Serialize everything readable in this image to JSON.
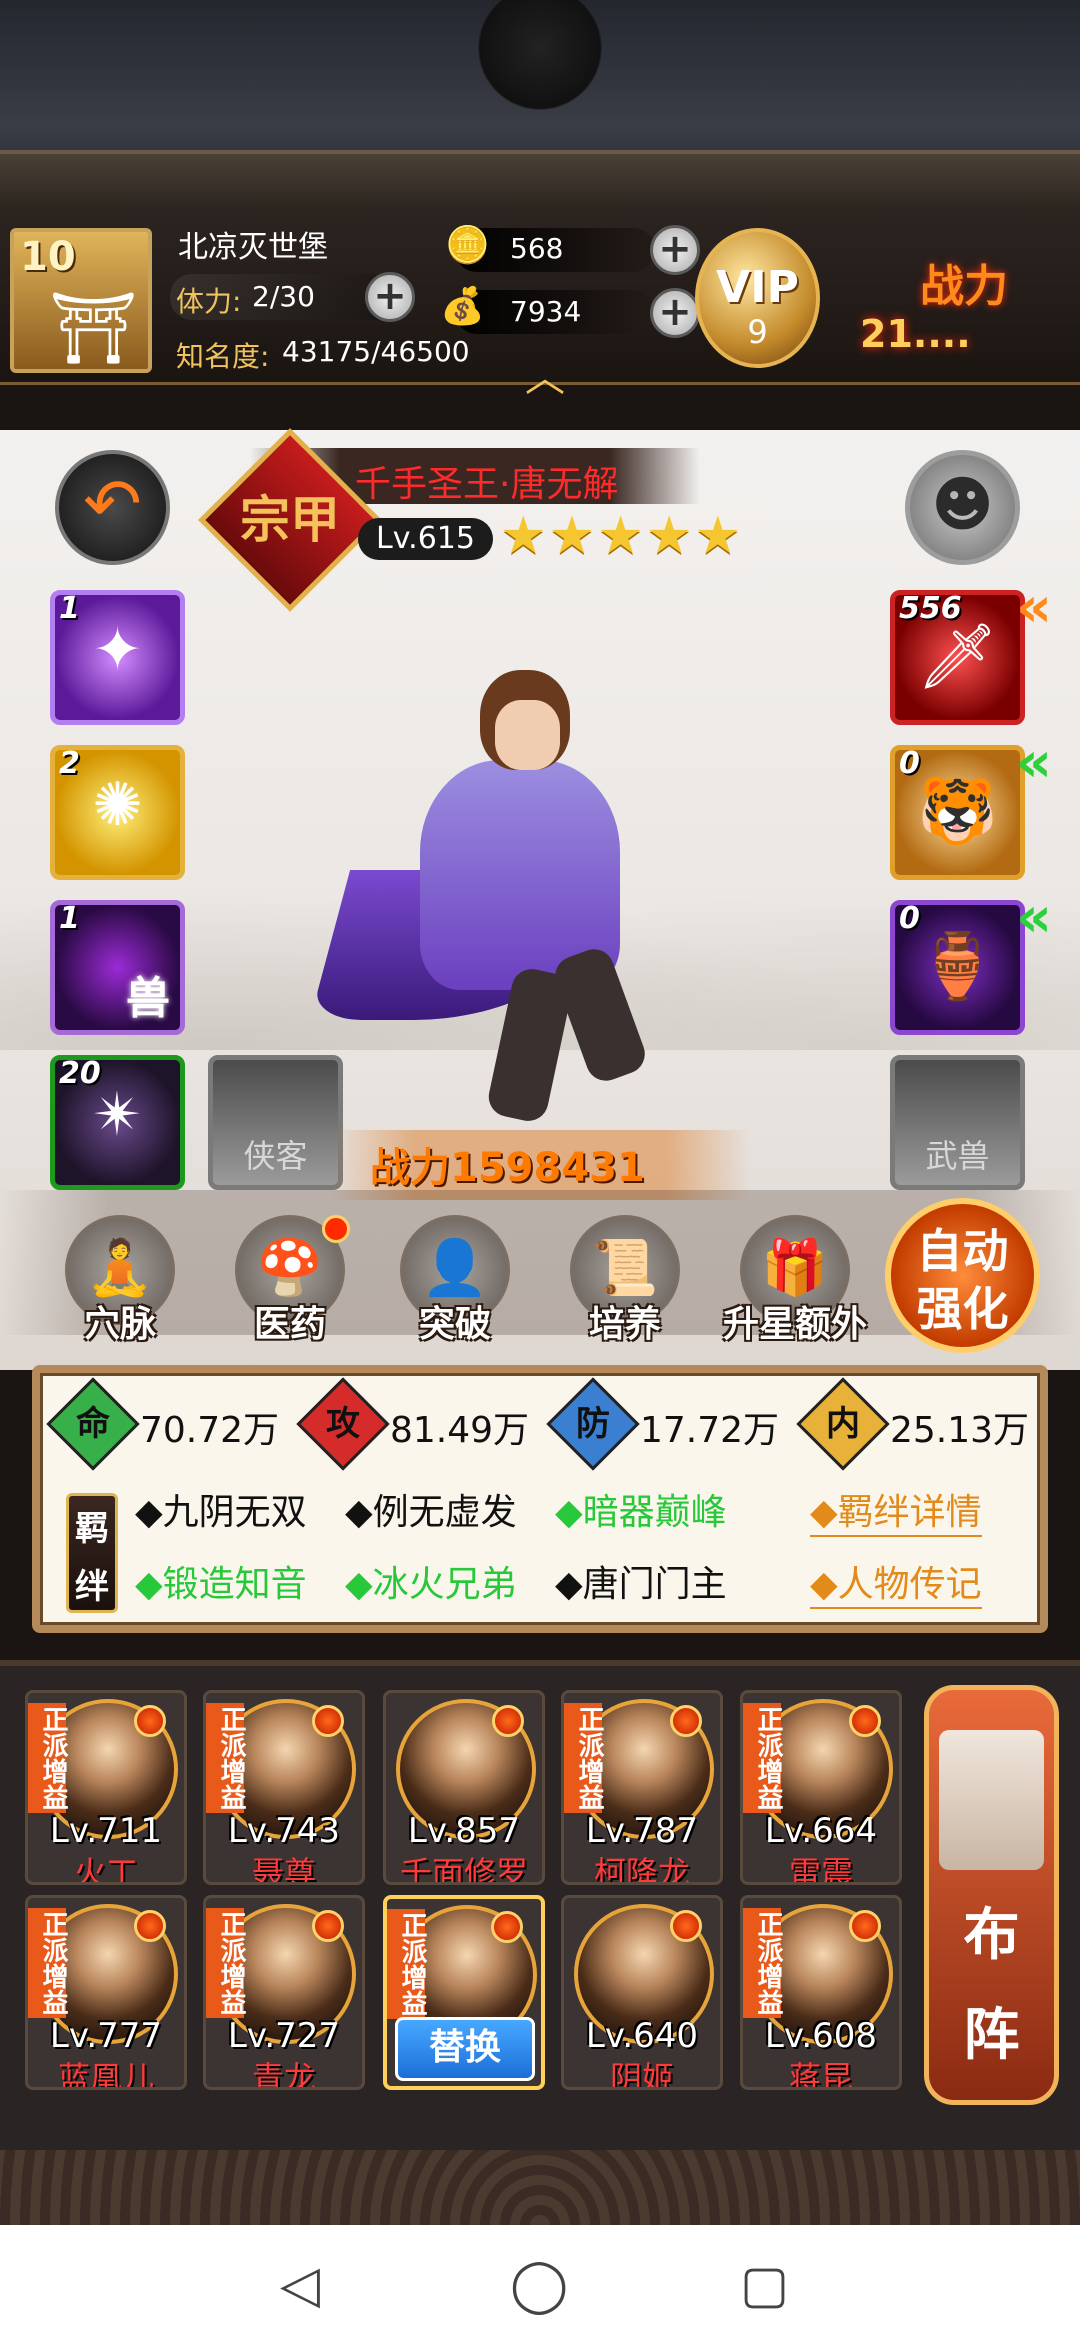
{
  "header": {
    "castle_level": "10",
    "castle_name": "北凉灭世堡",
    "stamina_label": "体力:",
    "stamina_value": "2/30",
    "fame_label": "知名度:",
    "fame_value": "43175/46500",
    "silver": "568",
    "gold": "7934",
    "vip_label": "VIP",
    "vip_level": "9",
    "power_label": "战力",
    "power_value": "21...."
  },
  "hero": {
    "rank_char": "宗甲",
    "name": "千手圣王·唐无解",
    "level": "Lv.615",
    "stars": "★★★★★",
    "power": "战力1598431"
  },
  "skills": [
    {
      "count": "1"
    },
    {
      "count": "2"
    },
    {
      "count": "1",
      "glyph_text": "兽"
    },
    {
      "count": "20"
    }
  ],
  "locked_slots": [
    {
      "label": "侠客"
    },
    {
      "label": "武兽"
    }
  ],
  "equipment": [
    {
      "count": "556"
    },
    {
      "count": "0"
    },
    {
      "count": "0"
    }
  ],
  "actions": [
    {
      "label": "穴脉",
      "icon": "meditation-icon"
    },
    {
      "label": "医药",
      "icon": "medicine-icon"
    },
    {
      "label": "突破",
      "icon": "breakthrough-icon"
    },
    {
      "label": "培养",
      "icon": "scroll-icon"
    },
    {
      "label": "升星额外",
      "icon": "star-up-icon"
    }
  ],
  "auto_button": {
    "line1": "自动",
    "line2": "强化"
  },
  "stats": {
    "life_icon": "命",
    "life": "70.72万",
    "attack_icon": "攻",
    "attack": "81.49万",
    "defense_icon": "防",
    "defense": "17.72万",
    "inner_icon": "内",
    "inner": "25.13万"
  },
  "bonds": {
    "seal": [
      "羁",
      "绊"
    ],
    "items": [
      {
        "text": "◆九阴无双"
      },
      {
        "text": "◆例无虚发"
      },
      {
        "text": "◆暗器巅峰"
      },
      {
        "text": "◆锻造知音"
      },
      {
        "text": "◆冰火兄弟"
      },
      {
        "text": "◆唐门门主"
      }
    ],
    "link_details": "◆羁绊详情",
    "link_bio": "◆人物传记"
  },
  "roster": {
    "tag": "正派增益",
    "heroes": [
      {
        "level": "Lv.711",
        "name": "火工"
      },
      {
        "level": "Lv.743",
        "name": "聂尊"
      },
      {
        "level": "Lv.857",
        "name": "千面修罗"
      },
      {
        "level": "Lv.787",
        "name": "柯降龙"
      },
      {
        "level": "Lv.664",
        "name": "雷震"
      },
      {
        "level": "Lv.777",
        "name": "蓝凰儿"
      },
      {
        "level": "Lv.727",
        "name": "青龙"
      },
      {
        "level": "",
        "name": ""
      },
      {
        "level": "Lv.640",
        "name": "阴姬"
      },
      {
        "level": "Lv.608",
        "name": "蒋昆"
      }
    ],
    "replace_label": "替换",
    "formation_line1": "布",
    "formation_line2": "阵"
  },
  "nav": {
    "back": "◁",
    "home": "◯",
    "recent": "▢"
  },
  "colors": {
    "active_bond": "#27c83a",
    "hero_name": "#ff2a2a",
    "link": "#e28a1a"
  }
}
